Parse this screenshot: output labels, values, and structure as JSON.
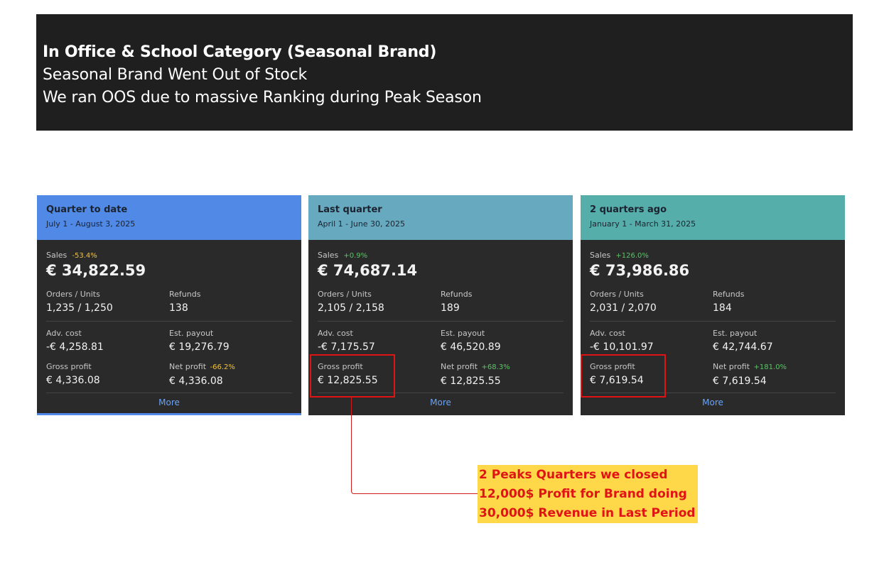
{
  "banner": {
    "line1": "In Office & School Category (Seasonal Brand)",
    "line2": "Seasonal Brand Went Out of Stock",
    "line3": "We ran OOS due to massive Ranking during Peak Season"
  },
  "labels": {
    "sales": "Sales",
    "orders_units": "Orders / Units",
    "refunds": "Refunds",
    "adv_cost": "Adv. cost",
    "est_payout": "Est. payout",
    "gross_profit": "Gross profit",
    "net_profit": "Net profit",
    "more": "More"
  },
  "cards": [
    {
      "title": "Quarter to date",
      "dates": "July 1 - August 3, 2025",
      "header_color": "#5089e6",
      "sales_change": "-53.4%",
      "sales": "€ 34,822.59",
      "orders_units": "1,235 / 1,250",
      "refunds": "138",
      "adv_cost": "-€ 4,258.81",
      "est_payout": "€ 19,276.79",
      "gross_profit": "€ 4,336.08",
      "net_profit_change": "-66.2%",
      "net_profit": "€ 4,336.08"
    },
    {
      "title": "Last quarter",
      "dates": "April 1 - June 30, 2025",
      "header_color": "#67a9bf",
      "sales_change": "+0.9%",
      "sales": "€ 74,687.14",
      "orders_units": "2,105 / 2,158",
      "refunds": "189",
      "adv_cost": "-€ 7,175.57",
      "est_payout": "€ 46,520.89",
      "gross_profit": "€ 12,825.55",
      "net_profit_change": "+68.3%",
      "net_profit": "€ 12,825.55"
    },
    {
      "title": "2 quarters ago",
      "dates": "January 1 - March 31, 2025",
      "header_color": "#56aeab",
      "sales_change": "+126.0%",
      "sales": "€ 73,986.86",
      "orders_units": "2,031 / 2,070",
      "refunds": "184",
      "adv_cost": "-€ 10,101.97",
      "est_payout": "€ 42,744.67",
      "gross_profit": "€ 7,619.54",
      "net_profit_change": "+181.0%",
      "net_profit": "€ 7,619.54"
    }
  ],
  "callout": {
    "line1": "2 Peaks Quarters we closed",
    "line2": "12,000$ Profit for Brand doing",
    "line3": "30,000$ Revenue in Last Period"
  },
  "colors": {
    "negative": "#f0c040",
    "positive": "#5ec26a",
    "highlight": "#e01414",
    "callout_bg": "#ffd84a"
  }
}
